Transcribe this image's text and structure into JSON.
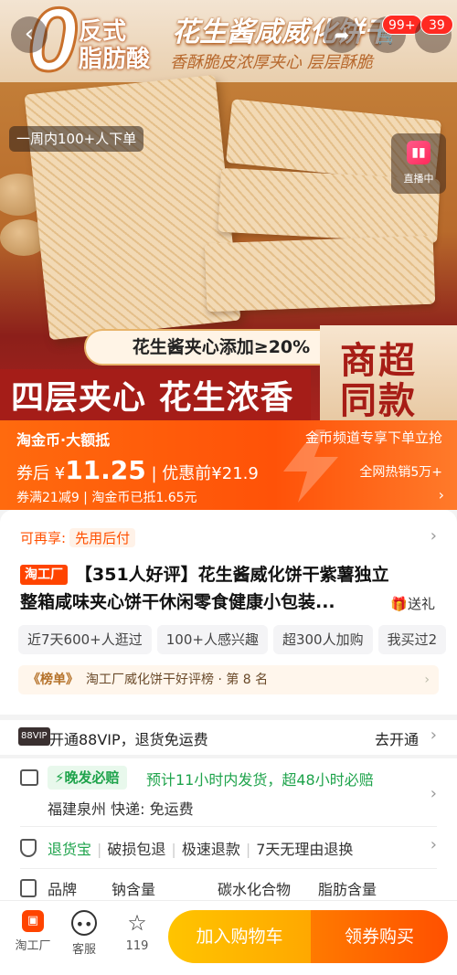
{
  "hero": {
    "zero": "0",
    "trans_fat_line1": "反式",
    "trans_fat_line2": "脂肪酸",
    "title": "花生酱咸威化饼干",
    "subtitle": "香酥脆皮浓厚夹心 层层酥脆",
    "buyers": "一周内100+人下单",
    "live_label": "直播中",
    "filling": "花生酱夹心添加≥20%",
    "bottom_text": "四层夹心 花生浓香",
    "mall_line1": "商超",
    "mall_line2": "同款"
  },
  "nav": {
    "back": "‹",
    "cart_count": "99+",
    "more_count": "39"
  },
  "price": {
    "coin_label": "淘金币·大额抵",
    "channel_promo": "金币频道专享下单立抢",
    "after_coupon_label": "券后 ¥",
    "after_coupon_price": "11.25",
    "before_label": "| 优惠前¥21.9",
    "hot_sales": "全网热销5万+",
    "coupon_note": "券满21减9 | 淘金币已抵1.65元",
    "arrow": "›"
  },
  "info": {
    "pay_label": "可再享:",
    "pay_chip": "先用后付",
    "brand_tag": "淘工厂",
    "title_line1": "【351人好评】花生酱威化饼干紫薯独立",
    "title_line2": "整箱咸味夹心饼干休闲零食健康小包装...",
    "gift": "送礼",
    "chips": [
      "近7天600+人逛过",
      "100+人感兴趣",
      "超300人加购",
      "我买过2"
    ],
    "rank_tag": "《榜单》",
    "rank_text": "淘工厂威化饼干好评榜 · 第 8 名"
  },
  "vip": {
    "logo": "88VIP",
    "text": "开通88VIP，退货免运费",
    "go": "去开通"
  },
  "delivery": {
    "promise": "⚡晚发必赔",
    "promise_text": "预计11小时内发货，超48小时必赔",
    "location": "福建泉州  快递: 免运费"
  },
  "service": {
    "guarantee": "退货宝",
    "items": [
      "破损包退",
      "极速退款",
      "7天无理由退换"
    ]
  },
  "specs": {
    "items": [
      "品牌",
      "钠含量",
      "碳水化合物",
      "脂肪含量"
    ]
  },
  "bottom_bar": {
    "shop": "淘工厂",
    "service": "客服",
    "fav_count": "119",
    "add_cart": "加入购物车",
    "buy": "领券购买"
  },
  "colors": {
    "accent": "#ff5000",
    "green": "#1ea34b",
    "cart_yellow": "#ffb300"
  }
}
